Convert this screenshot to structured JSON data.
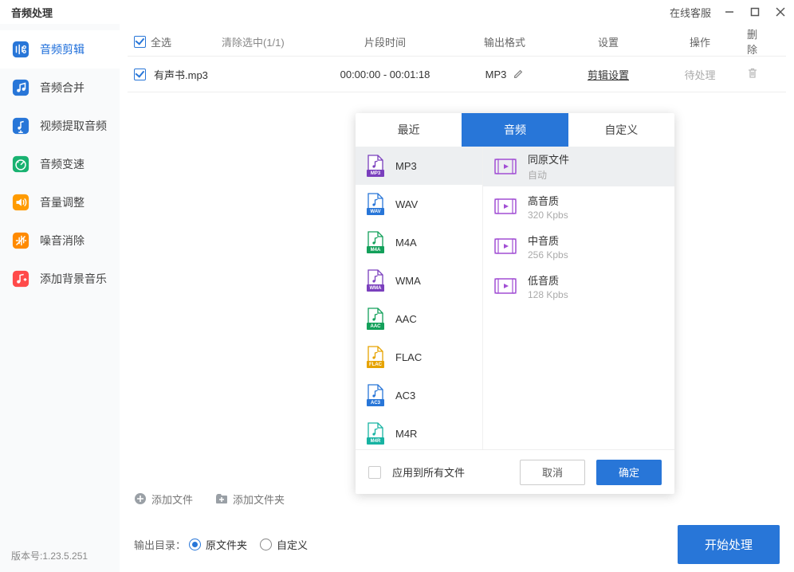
{
  "app_title": "音频处理",
  "titlebar": {
    "online_service": "在线客服"
  },
  "sidebar": {
    "items": [
      {
        "label": "音频剪辑",
        "color": "#2876d8"
      },
      {
        "label": "音频合并",
        "color": "#2876d8"
      },
      {
        "label": "视频提取音频",
        "color": "#2876d8"
      },
      {
        "label": "音频变速",
        "color": "#19b271"
      },
      {
        "label": "音量调整",
        "color": "#ff9b00"
      },
      {
        "label": "噪音消除",
        "color": "#ff8a00"
      },
      {
        "label": "添加背景音乐",
        "color": "#ff4a4a"
      }
    ],
    "version": "版本号:1.23.5.251"
  },
  "table": {
    "select_all": "全选",
    "clear_selected": "清除选中(1/1)",
    "col_time": "片段时间",
    "col_format": "输出格式",
    "col_settings": "设置",
    "col_ops": "操作",
    "col_delete": "删除",
    "row": {
      "filename": "有声书.mp3",
      "time_range": "00:00:00 - 00:01:18",
      "format": "MP3",
      "settings_link": "剪辑设置",
      "status": "待处理"
    }
  },
  "dropdown": {
    "tabs": {
      "recent": "最近",
      "audio": "音频",
      "custom": "自定义"
    },
    "formats": [
      {
        "label": "MP3",
        "badge_color": "#7a3fbd"
      },
      {
        "label": "WAV",
        "badge_color": "#2876d8"
      },
      {
        "label": "M4A",
        "badge_color": "#13a05a"
      },
      {
        "label": "WMA",
        "badge_color": "#7a3fbd"
      },
      {
        "label": "AAC",
        "badge_color": "#13a05a"
      },
      {
        "label": "FLAC",
        "badge_color": "#e6a300"
      },
      {
        "label": "AC3",
        "badge_color": "#2876d8"
      },
      {
        "label": "M4R",
        "badge_color": "#17b3a2"
      }
    ],
    "qualities": [
      {
        "title": "同原文件",
        "sub": "自动"
      },
      {
        "title": "高音质",
        "sub": "320 Kpbs"
      },
      {
        "title": "中音质",
        "sub": "256 Kpbs"
      },
      {
        "title": "低音质",
        "sub": "128 Kpbs"
      }
    ],
    "apply_all": "应用到所有文件",
    "cancel": "取消",
    "ok": "确定"
  },
  "footer": {
    "add_file": "添加文件",
    "add_folder": "添加文件夹",
    "output_dir_label": "输出目录：",
    "radio_original": "原文件夹",
    "radio_custom": "自定义",
    "start": "开始处理"
  }
}
